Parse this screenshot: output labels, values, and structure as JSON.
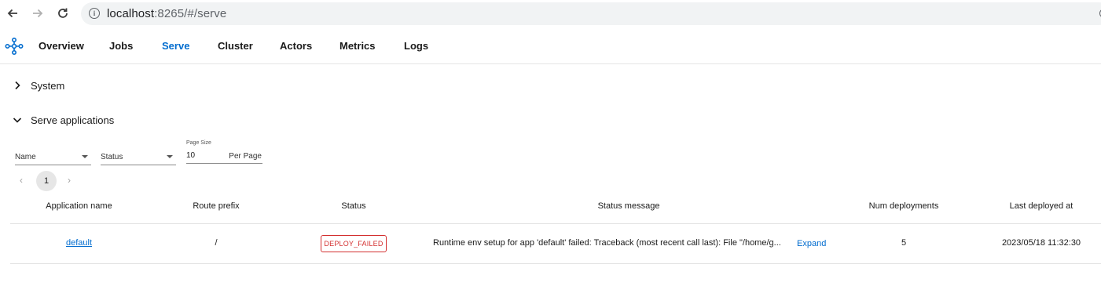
{
  "browser": {
    "back_icon": "arrow-left-icon",
    "forward_icon": "arrow-right-icon",
    "reload_icon": "reload-icon",
    "url_host": "localhost",
    "url_rest": ":8265/#/serve"
  },
  "nav": {
    "tabs": [
      {
        "label": "Overview"
      },
      {
        "label": "Jobs"
      },
      {
        "label": "Serve"
      },
      {
        "label": "Cluster"
      },
      {
        "label": "Actors"
      },
      {
        "label": "Metrics"
      },
      {
        "label": "Logs"
      }
    ],
    "active": "Serve",
    "accent_color": "#036dcf"
  },
  "sections": {
    "system": {
      "title": "System",
      "expanded": false
    },
    "serve_apps": {
      "title": "Serve applications",
      "expanded": true
    }
  },
  "filters": {
    "name_label": "Name",
    "status_label": "Status",
    "page_size_label": "Page Size",
    "page_size_value": "10",
    "page_size_unit": "Per Page"
  },
  "pagination": {
    "current": "1",
    "prev": "‹",
    "next": "›"
  },
  "table": {
    "headers": [
      "Application name",
      "Route prefix",
      "Status",
      "Status message",
      "Num deployments",
      "Last deployed at"
    ],
    "rows": [
      {
        "name": "default",
        "route_prefix": "/",
        "status": "DEPLOY_FAILED",
        "status_message": "Runtime env setup for app 'default' failed: Traceback (most recent call last): File \"/home/g...",
        "expand": "Expand",
        "num_deployments": "5",
        "last_deployed": "2023/05/18 11:32:30"
      }
    ]
  }
}
